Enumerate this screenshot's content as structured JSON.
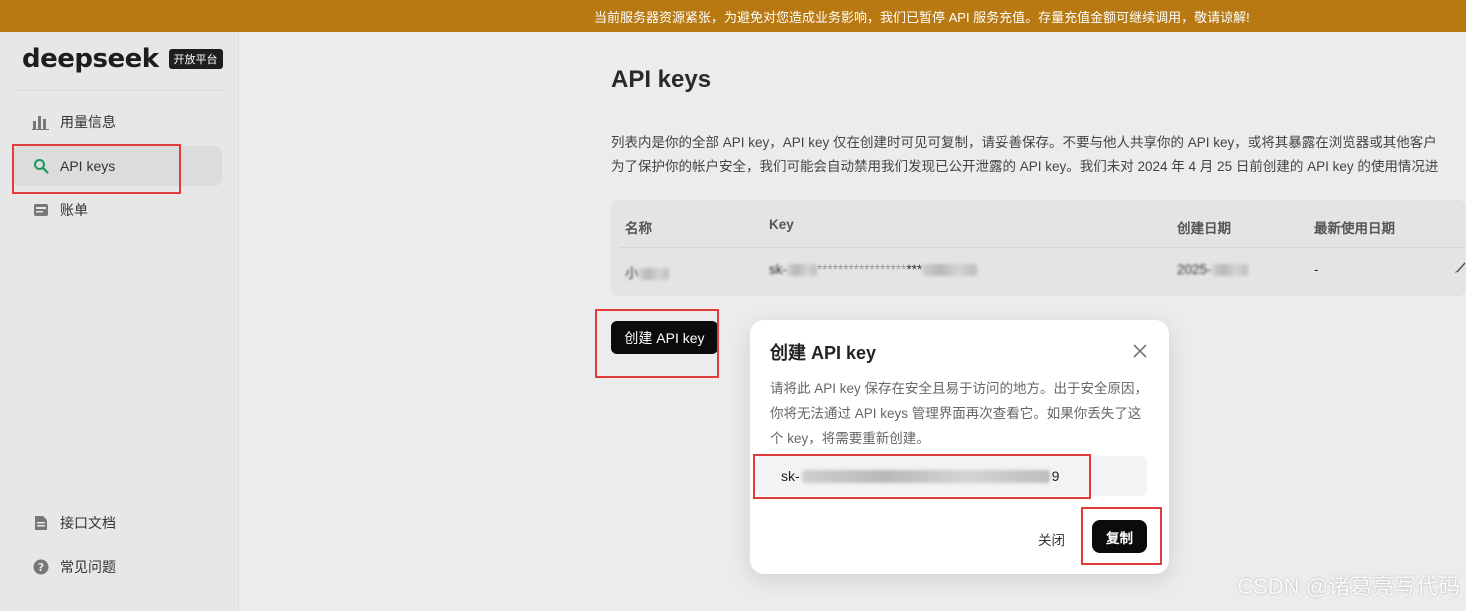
{
  "banner": {
    "text": "当前服务器资源紧张，为避免对您造成业务影响，我们已暂停 API 服务充值。存量充值金额可继续调用，敬请谅解!"
  },
  "brand": {
    "name": "deepseek",
    "badge": "开放平台"
  },
  "sidebar": {
    "items": [
      {
        "label": "用量信息",
        "icon": "bar-chart-icon"
      },
      {
        "label": "API keys",
        "icon": "search-key-icon",
        "active": true
      },
      {
        "label": "账单",
        "icon": "wallet-icon"
      }
    ],
    "bottom_items": [
      {
        "label": "接口文档",
        "icon": "document-icon"
      },
      {
        "label": "常见问题",
        "icon": "help-icon"
      }
    ]
  },
  "main": {
    "title": "API keys",
    "desc_line1": "列表内是你的全部 API key，API key 仅在创建时可见可复制，请妥善保存。不要与他人共享你的 API key，或将其暴露在浏览器或其他客户",
    "desc_line2": "为了保护你的帐户安全，我们可能会自动禁用我们发现已公开泄露的 API key。我们未对 2024 年 4 月 25 日前创建的 API key 的使用情况进",
    "table": {
      "columns": [
        "名称",
        "Key",
        "创建日期",
        "最新使用日期"
      ],
      "rows": [
        {
          "name": "小",
          "key": "sk-",
          "key_mask": "*****************",
          "key_tail": "***",
          "created": "2025-",
          "last_used": "-"
        }
      ]
    },
    "create_button": "创建 API key"
  },
  "modal": {
    "title": "创建 API key",
    "text": "请将此 API key 保存在安全且易于访问的地方。出于安全原因，你将无法通过 API keys 管理界面再次查看它。如果你丢失了这个 key，将需要重新创建。",
    "key_prefix": "sk-",
    "key_suffix": "9",
    "close_label": "关闭",
    "copy_label": "复制"
  },
  "watermark": "CSDN @诸葛亮写代码",
  "colors": {
    "banner": "#b87912",
    "highlight": "#e23b3b",
    "button": "#0b0b0b"
  }
}
